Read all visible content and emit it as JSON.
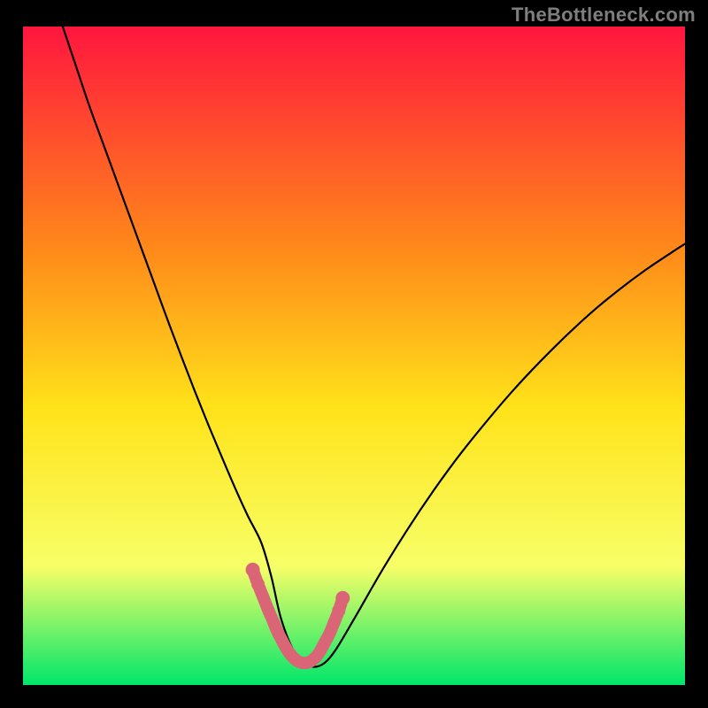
{
  "watermark": "TheBottleneck.com",
  "colors": {
    "bg": "#000000",
    "grad_top": "#ff163e",
    "grad_mid1": "#ff8a1a",
    "grad_mid2": "#ffe31a",
    "grad_mid3": "#f7ff68",
    "grad_bottom": "#00e66a",
    "curve": "#000000",
    "highlight_stroke": "#d96576",
    "highlight_fill": "#d96576"
  },
  "chart_data": {
    "type": "line",
    "title": "",
    "xlabel": "",
    "ylabel": "",
    "xlim": [
      0,
      100
    ],
    "ylim": [
      0,
      100
    ],
    "series": [
      {
        "name": "bottleneck-curve",
        "x": [
          6,
          8,
          10,
          12,
          14,
          16,
          18,
          20,
          22,
          24,
          26,
          28,
          30,
          32,
          34,
          36,
          37.5,
          39,
          41,
          43,
          45,
          47,
          50,
          54,
          58,
          62,
          66,
          70,
          74,
          78,
          82,
          86,
          90,
          94,
          98,
          100
        ],
        "y": [
          100,
          94,
          88,
          82.5,
          77,
          71.5,
          66,
          60.5,
          55,
          49.7,
          44.5,
          39.5,
          34.7,
          30,
          25.6,
          21.6,
          16.5,
          10,
          5,
          3,
          3,
          5,
          10,
          17,
          23.5,
          29.5,
          35,
          40,
          44.7,
          49,
          53,
          56.7,
          60,
          63,
          65.7,
          67
        ],
        "style": "thin-black"
      }
    ],
    "highlight_segment": {
      "note": "thick salmon U-shaped overlay near minimum",
      "x": [
        34.7,
        35.5,
        36.3,
        37,
        37.7,
        38.3,
        39,
        40,
        41,
        42,
        43,
        44,
        44.8,
        45.5,
        46.3,
        47,
        47.7,
        48.3
      ],
      "y": [
        17.5,
        15.3,
        13.3,
        11.5,
        9.9,
        8.4,
        7,
        5.2,
        4,
        3.4,
        3.4,
        4,
        5,
        6.3,
        7.8,
        9.5,
        11.3,
        13.2
      ],
      "endpoint_dots": true
    }
  }
}
